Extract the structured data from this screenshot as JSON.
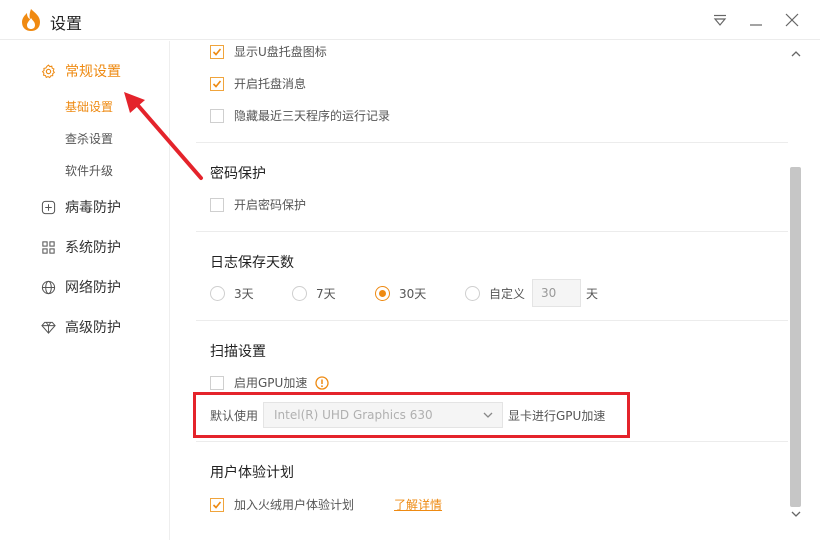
{
  "window": {
    "title": "设置"
  },
  "sidebar": {
    "items": [
      {
        "label": "常规设置",
        "icon": "gear-icon",
        "active": true
      },
      {
        "label": "病毒防护",
        "icon": "plus-square-icon",
        "active": false
      },
      {
        "label": "系统防护",
        "icon": "grid-icon",
        "active": false
      },
      {
        "label": "网络防护",
        "icon": "globe-icon",
        "active": false
      },
      {
        "label": "高级防护",
        "icon": "diamond-icon",
        "active": false
      }
    ],
    "subitems": [
      {
        "label": "基础设置",
        "active": true
      },
      {
        "label": "查杀设置",
        "active": false
      },
      {
        "label": "软件升级",
        "active": false
      }
    ]
  },
  "tray": {
    "show_tray_icon": {
      "label": "显示U盘托盘图标",
      "checked": true
    },
    "tray_message": {
      "label": "开启托盘消息",
      "checked": true
    },
    "hide_history": {
      "label": "隐藏最近三天程序的运行记录",
      "checked": false
    }
  },
  "password": {
    "title": "密码保护",
    "enable": {
      "label": "开启密码保护",
      "checked": false
    }
  },
  "log": {
    "title": "日志保存天数",
    "options": [
      "3天",
      "7天",
      "30天",
      "自定义"
    ],
    "selected": "30天",
    "custom_value": "30",
    "unit": "天"
  },
  "scan": {
    "title": "扫描设置",
    "gpu_accel": {
      "label": "启用GPU加速",
      "checked": false
    },
    "default_use": "默认使用",
    "gpu_model": "Intel(R) UHD Graphics 630",
    "gpu_suffix": "显卡进行GPU加速"
  },
  "ux": {
    "title": "用户体验计划",
    "join": {
      "label": "加入火绒用户体验计划",
      "checked": true
    },
    "link": "了解详情"
  },
  "colors": {
    "accent": "#ee8a12",
    "highlight": "#e4232b"
  }
}
